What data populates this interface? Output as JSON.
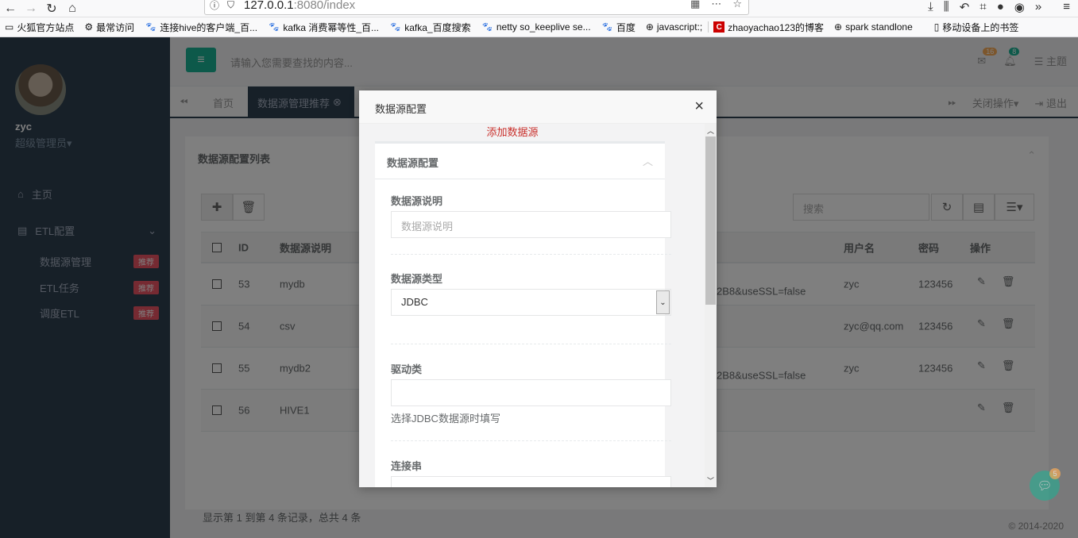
{
  "browser": {
    "url_host": "127.0.0.1",
    "url_rest": ":8080/index",
    "bookmarks": [
      {
        "label": "火狐官方站点",
        "icon": "folder-icon"
      },
      {
        "label": "最常访问",
        "icon": "gear-icon"
      },
      {
        "label": "连接hive的客户端_百...",
        "icon": "paw-icon"
      },
      {
        "label": "kafka 消费幂等性_百...",
        "icon": "paw-icon"
      },
      {
        "label": "kafka_百度搜索",
        "icon": "paw-icon"
      },
      {
        "label": "netty so_keeplive se...",
        "icon": "paw-icon"
      },
      {
        "label": "百度",
        "icon": "paw-icon"
      },
      {
        "label": "javascript:;",
        "icon": "globe-icon"
      },
      {
        "label": "zhaoyachao123的博客",
        "icon": "csdn-icon"
      },
      {
        "label": "spark standlone",
        "icon": "globe-icon"
      },
      {
        "label": "移动设备上的书签",
        "icon": "mobile-icon"
      }
    ]
  },
  "sidebar": {
    "user_name": "zyc",
    "user_role": "超级管理员▾",
    "home_label": "主页",
    "etl_group_label": "ETL配置",
    "sub_items": [
      {
        "label": "数据源管理",
        "badge": "推荐"
      },
      {
        "label": "ETL任务",
        "badge": "推荐"
      },
      {
        "label": "调度ETL",
        "badge": "推荐"
      }
    ]
  },
  "topbar": {
    "search_placeholder": "请输入您需要查找的内容...",
    "mail_count": "16",
    "bell_count": "8",
    "theme_label": "主题"
  },
  "tabs": {
    "home": "首页",
    "active": "数据源管理推荐",
    "close_ops": "关闭操作▾",
    "logout": "退出"
  },
  "panel": {
    "title": "数据源配置列表",
    "search_placeholder": "搜索",
    "columns": {
      "id": "ID",
      "desc": "数据源说明",
      "user": "用户名",
      "pwd": "密码",
      "ops": "操作"
    },
    "rows": [
      {
        "id": "53",
        "desc": "mydb",
        "url": "2B8&useSSL=false",
        "user": "zyc",
        "pwd": "123456"
      },
      {
        "id": "54",
        "desc": "csv",
        "url": "",
        "user": "zyc@qq.com",
        "pwd": "123456"
      },
      {
        "id": "55",
        "desc": "mydb2",
        "url": "2B8&useSSL=false",
        "user": "zyc",
        "pwd": "123456"
      },
      {
        "id": "56",
        "desc": "HIVE1",
        "url": "",
        "user": "",
        "pwd": ""
      }
    ],
    "footer": "显示第 1 到第 4 条记录，总共 4 条"
  },
  "copyright": "© 2014-2020",
  "chat_badge": "5",
  "modal": {
    "title": "数据源配置",
    "add_link": "添加数据源",
    "section_title": "数据源配置",
    "desc_label": "数据源说明",
    "desc_placeholder": "数据源说明",
    "type_label": "数据源类型",
    "type_value": "JDBC",
    "driver_label": "驱动类",
    "driver_value": "",
    "driver_help": "选择JDBC数据源时填写",
    "conn_label": "连接串"
  },
  "colors": {
    "accent": "#1ab394",
    "sidebar": "#2f4050",
    "danger": "#ed5565",
    "warning": "#f8ac59"
  }
}
